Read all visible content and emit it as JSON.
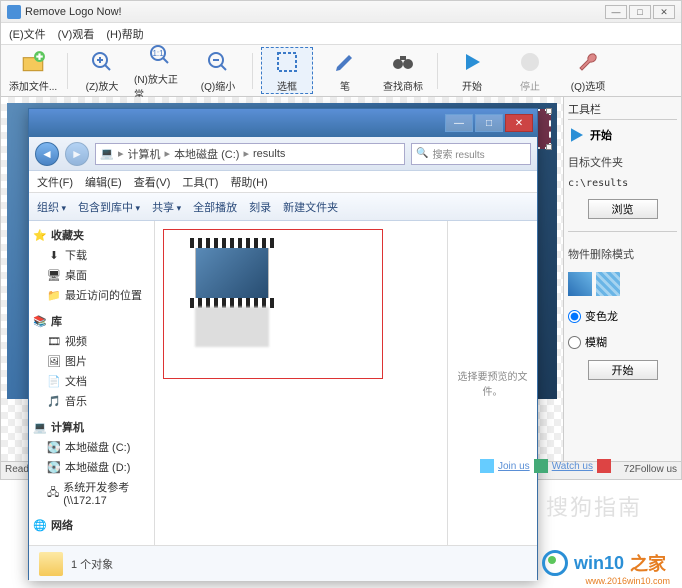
{
  "app": {
    "title": "Remove Logo Now!",
    "menu": [
      "(E)文件",
      "(V)观看",
      "(H)帮助"
    ],
    "toolbar": [
      {
        "id": "add",
        "label": "添加文件..."
      },
      {
        "id": "zoomin",
        "label": "(Z)放大"
      },
      {
        "id": "zoomfit",
        "label": "(N)放大正常"
      },
      {
        "id": "zoomout",
        "label": "(Q)缩小"
      },
      {
        "id": "select",
        "label": "选框",
        "selected": true
      },
      {
        "id": "pen",
        "label": "笔"
      },
      {
        "id": "find",
        "label": "查找商标"
      },
      {
        "id": "start",
        "label": "开始"
      },
      {
        "id": "stop",
        "label": "停止"
      },
      {
        "id": "options",
        "label": "(Q)选项"
      }
    ],
    "status_left": "Read",
    "status_right": "72Follow us",
    "foot_links": [
      "Join us",
      "Watch us"
    ]
  },
  "panel": {
    "title": "工具栏",
    "start": "开始",
    "target_label": "目标文件夹",
    "target_path": "c:\\results",
    "browse": "浏览",
    "mode_label": "物件删除模式",
    "mode_a": "变色龙",
    "mode_b": "模糊",
    "go": "开始"
  },
  "explorer": {
    "breadcrumb": [
      "计算机",
      "本地磁盘 (C:)",
      "results"
    ],
    "search_placeholder": "搜索 results",
    "menu": [
      "文件(F)",
      "编辑(E)",
      "查看(V)",
      "工具(T)",
      "帮助(H)"
    ],
    "toolbar": {
      "organize": "组织",
      "include": "包含到库中",
      "share": "共享",
      "play": "全部播放",
      "burn": "刻录",
      "newfolder": "新建文件夹"
    },
    "tree": {
      "favorites": {
        "label": "收藏夹",
        "items": [
          "下载",
          "桌面",
          "最近访问的位置"
        ]
      },
      "libraries": {
        "label": "库",
        "items": [
          "视频",
          "图片",
          "文档",
          "音乐"
        ]
      },
      "computer": {
        "label": "计算机",
        "items": [
          "本地磁盘 (C:)",
          "本地磁盘 (D:)",
          "系统开发参考 (\\\\172.17"
        ]
      },
      "network": {
        "label": "网络"
      }
    },
    "preview_hint": "选择要预览的文件。",
    "status": "1 个对象"
  },
  "watermark": {
    "sogou": "搜狗指南",
    "brand_a": "win10",
    "brand_b": "之家",
    "url": "www.2016win10.com"
  }
}
